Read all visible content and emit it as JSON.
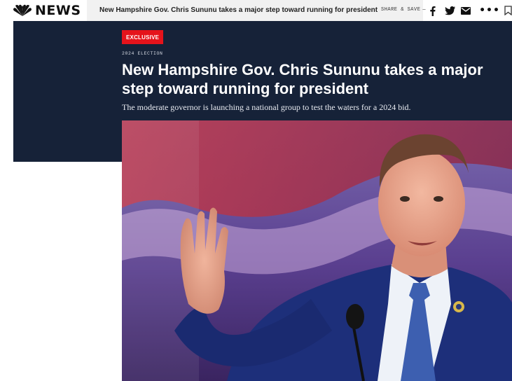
{
  "site": {
    "logo_text": "NEWS",
    "logo_icon": "nbc-peacock-icon"
  },
  "sticky_bar": {
    "title": "New Hampshire Gov. Chris Sununu takes a major step toward running for president"
  },
  "share": {
    "label": "SHARE & SAVE",
    "dash": "—",
    "icons": [
      "facebook-icon",
      "twitter-icon",
      "email-icon",
      "more-icon",
      "bookmark-icon"
    ],
    "more_text": "•••"
  },
  "article": {
    "badge": "EXCLUSIVE",
    "eyebrow": "2024 ELECTION",
    "headline": "New Hampshire Gov. Chris Sununu takes a major step toward running for president",
    "dek": "The moderate governor is launching a national group to test the waters for a 2024 bid."
  },
  "colors": {
    "hero_background": "#162238",
    "badge_red": "#e5131b",
    "sticky_bar_background": "#f1f1f1"
  }
}
